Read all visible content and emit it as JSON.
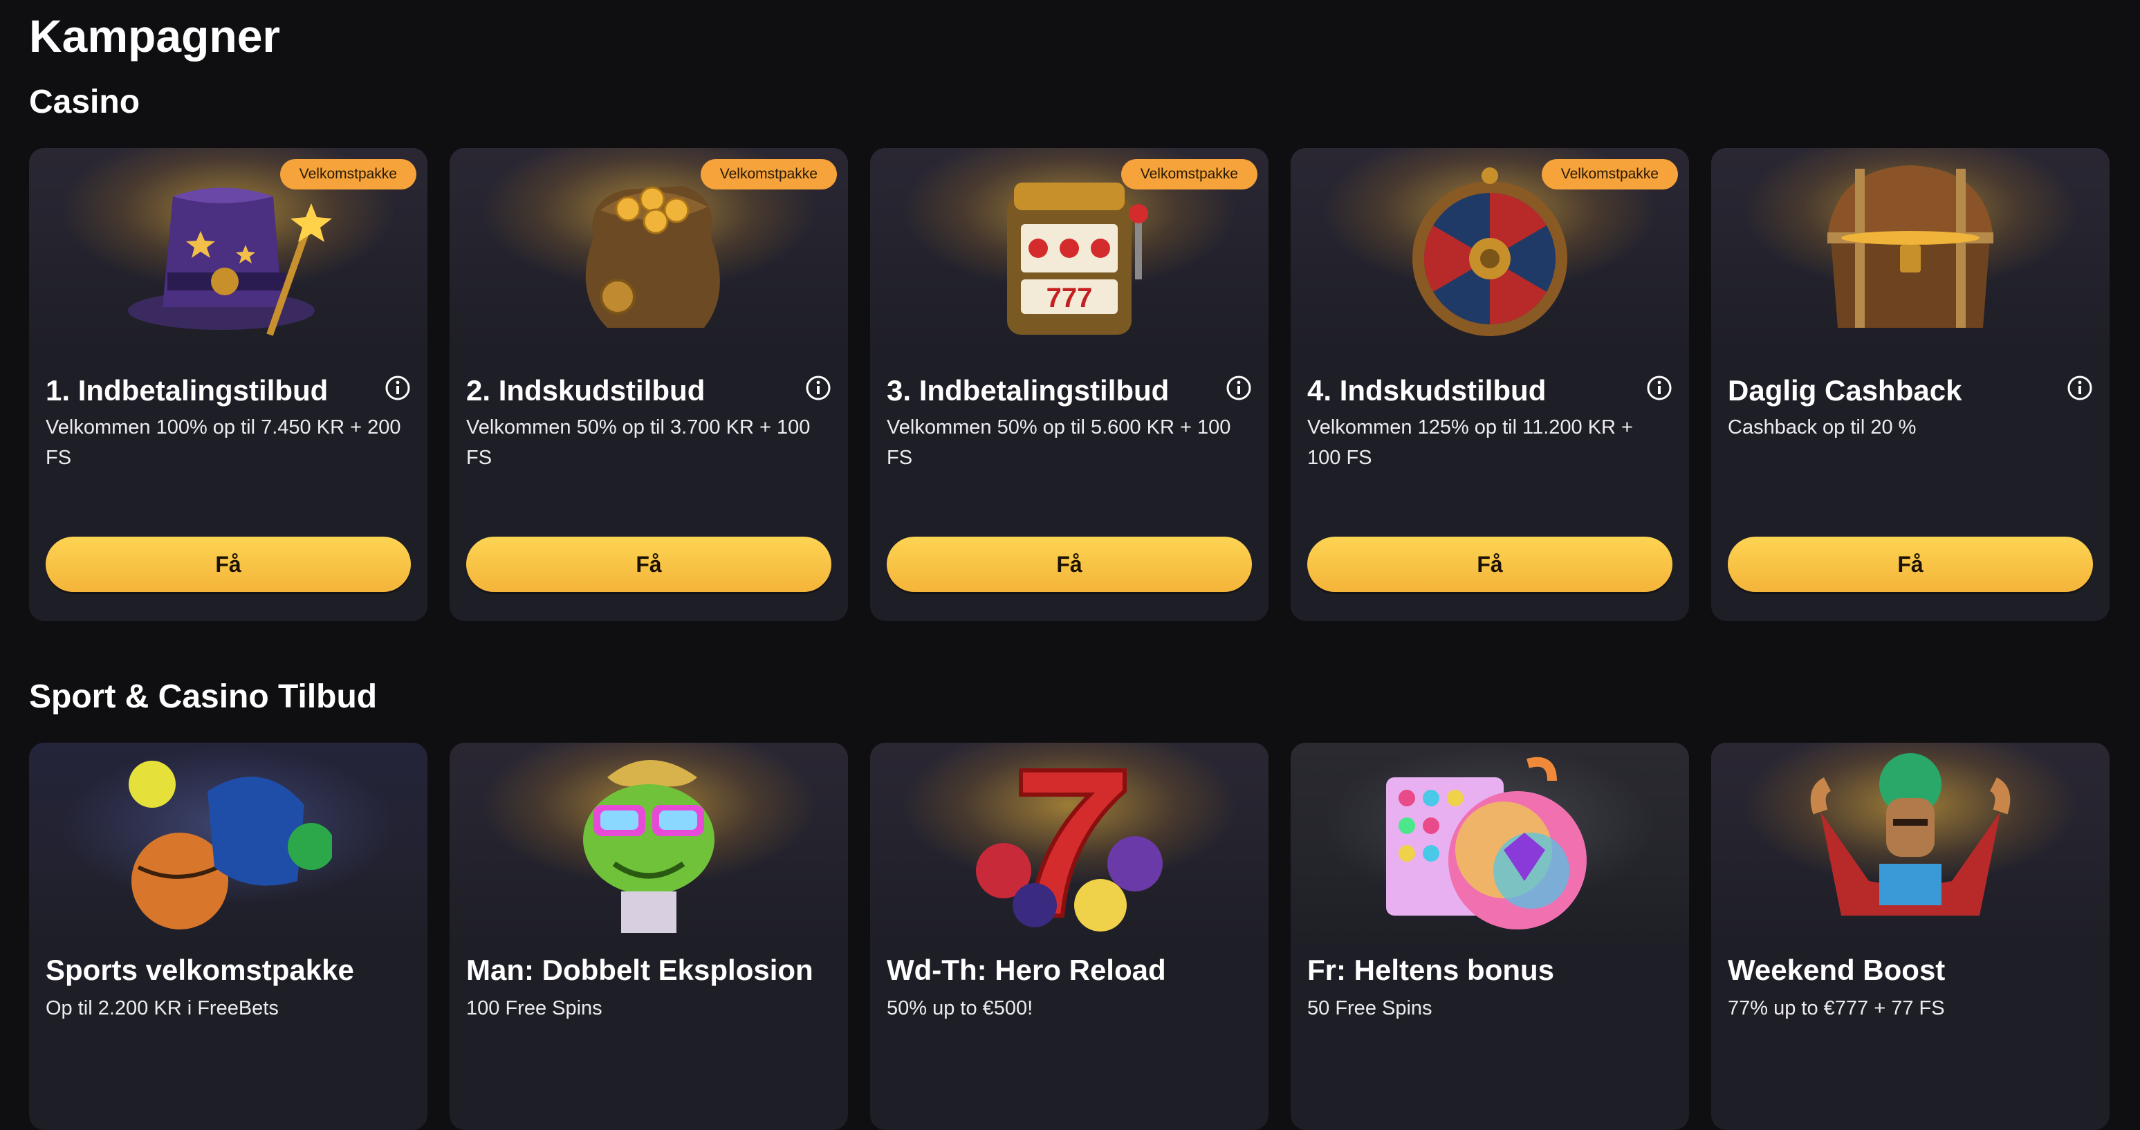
{
  "page": {
    "title": "Kampagner"
  },
  "sections": {
    "casino": {
      "title": "Casino",
      "cards": [
        {
          "title": "1. Indbetalingstilbud",
          "desc": "Velkommen 100% op til 7.450 KR + 200 FS",
          "badge": "Velkomstpakke",
          "cta": "Få",
          "art": "wizard-hat-icon"
        },
        {
          "title": "2. Indskudstilbud",
          "desc": "Velkommen 50% op til 3.700 KR + 100 FS",
          "badge": "Velkomstpakke",
          "cta": "Få",
          "art": "coin-bag-icon"
        },
        {
          "title": "3. Indbetalingstilbud",
          "desc": "Velkommen 50% op til 5.600 KR + 100 FS",
          "badge": "Velkomstpakke",
          "cta": "Få",
          "art": "slot-machine-icon"
        },
        {
          "title": "4. Indskudstilbud",
          "desc": "Velkommen 125% op til 11.200 KR + 100 FS",
          "badge": "Velkomstpakke",
          "cta": "Få",
          "art": "prize-wheel-icon"
        },
        {
          "title": "Daglig Cashback",
          "desc": "Cashback op til 20 %",
          "badge": "",
          "cta": "Få",
          "art": "treasure-chest-icon"
        }
      ]
    },
    "sport": {
      "title": "Sport & Casino Tilbud",
      "cards": [
        {
          "title": "Sports velkomstpakke",
          "desc": "Op til 2.200 KR i FreeBets",
          "art": "sports-balls-icon"
        },
        {
          "title": "Man: Dobbelt Eksplosion",
          "desc": "100 Free Spins",
          "art": "frog-character-icon"
        },
        {
          "title": "Wd-Th: Hero Reload",
          "desc": "50% up to €500!",
          "art": "lucky-seven-icon"
        },
        {
          "title": "Fr: Heltens bonus",
          "desc": "50 Free Spins",
          "art": "candy-gems-icon"
        },
        {
          "title": "Weekend Boost",
          "desc": "77% up to €777 + 77 FS",
          "art": "aztec-warrior-icon"
        }
      ]
    }
  },
  "colors": {
    "background": "#0f0f12",
    "card": "#1e1e26",
    "badge": "#f5a33a",
    "cta_top": "#fdd453",
    "cta_bottom": "#f4b43a"
  }
}
